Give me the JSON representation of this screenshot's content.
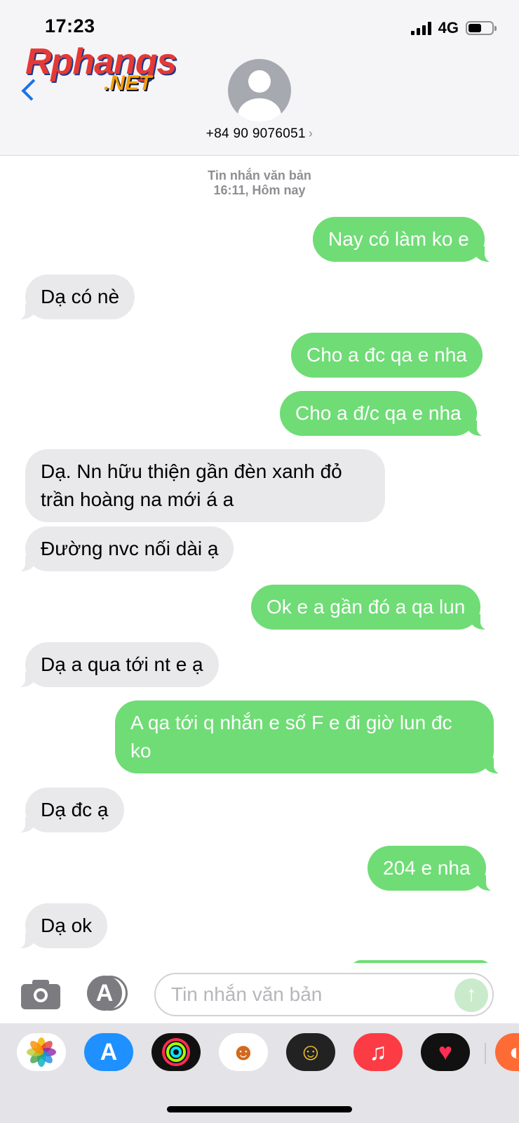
{
  "status_bar": {
    "time": "17:23",
    "network": "4G"
  },
  "header": {
    "logo_main": "Rphangs",
    "logo_net": ".NET",
    "contact_name": "+84 90 9076051",
    "contact_chevron": "›"
  },
  "thread_meta": {
    "line1": "Tin nhắn văn bản",
    "line2": "16:11, Hôm nay"
  },
  "messages": [
    {
      "from": "me",
      "text": "Nay có làm ko e"
    },
    {
      "from": "them",
      "text": "Dạ có nè"
    },
    {
      "from": "me",
      "text": "Cho a đc qa e nha"
    },
    {
      "from": "me",
      "text": "Cho a đ/c qa e nha"
    },
    {
      "from": "them",
      "text": "Dạ. Nn hữu thiện gần đèn xanh đỏ\ntrần hoàng na mới á a"
    },
    {
      "from": "them",
      "text": "Đường nvc nối dài ạ"
    },
    {
      "from": "me",
      "text": "Ok e a gần đó a qa lun"
    },
    {
      "from": "them",
      "text": "Dạ a qua tới nt e ạ"
    },
    {
      "from": "me",
      "text": "A qa tới q nhắn e số F e đi giờ lun đc\nko"
    },
    {
      "from": "them",
      "text": "Dạ đc ạ"
    },
    {
      "from": "me",
      "text": "204 e nha"
    },
    {
      "from": "them",
      "text": "Dạ ok"
    }
  ],
  "input_bar": {
    "placeholder": "Tin nhắn văn bản",
    "camera_icon": "camera-icon",
    "apps_icon": "app-store-icon",
    "send_icon": "arrow-up-icon",
    "apps_glyph": "A",
    "send_glyph": "↑"
  },
  "app_tray": [
    {
      "name": "photos",
      "glyph": "✿",
      "bg": "#ffffff",
      "fg": "#e74c3c"
    },
    {
      "name": "app-store",
      "glyph": "A",
      "bg": "#1e90ff",
      "fg": "#ffffff"
    },
    {
      "name": "activity",
      "glyph": "◎",
      "bg": "#111111",
      "fg": "#7cfc00"
    },
    {
      "name": "memoji-stickers",
      "glyph": "☻",
      "bg": "#ffffff",
      "fg": "#d2691e"
    },
    {
      "name": "memoji",
      "glyph": "☺",
      "bg": "#222222",
      "fg": "#f4c430"
    },
    {
      "name": "music",
      "glyph": "♫",
      "bg": "#fc3c44",
      "fg": "#ffffff"
    },
    {
      "name": "digital-touch",
      "glyph": "♥",
      "bg": "#111111",
      "fg": "#ff2d55"
    },
    {
      "name": "more-apps",
      "glyph": "◐",
      "bg": "#ff6b35",
      "fg": "#ffffff"
    }
  ],
  "colors": {
    "sent_bubble": "#6fdc76",
    "received_bubble": "#e9e9eb",
    "accent": "#1a73e8"
  }
}
